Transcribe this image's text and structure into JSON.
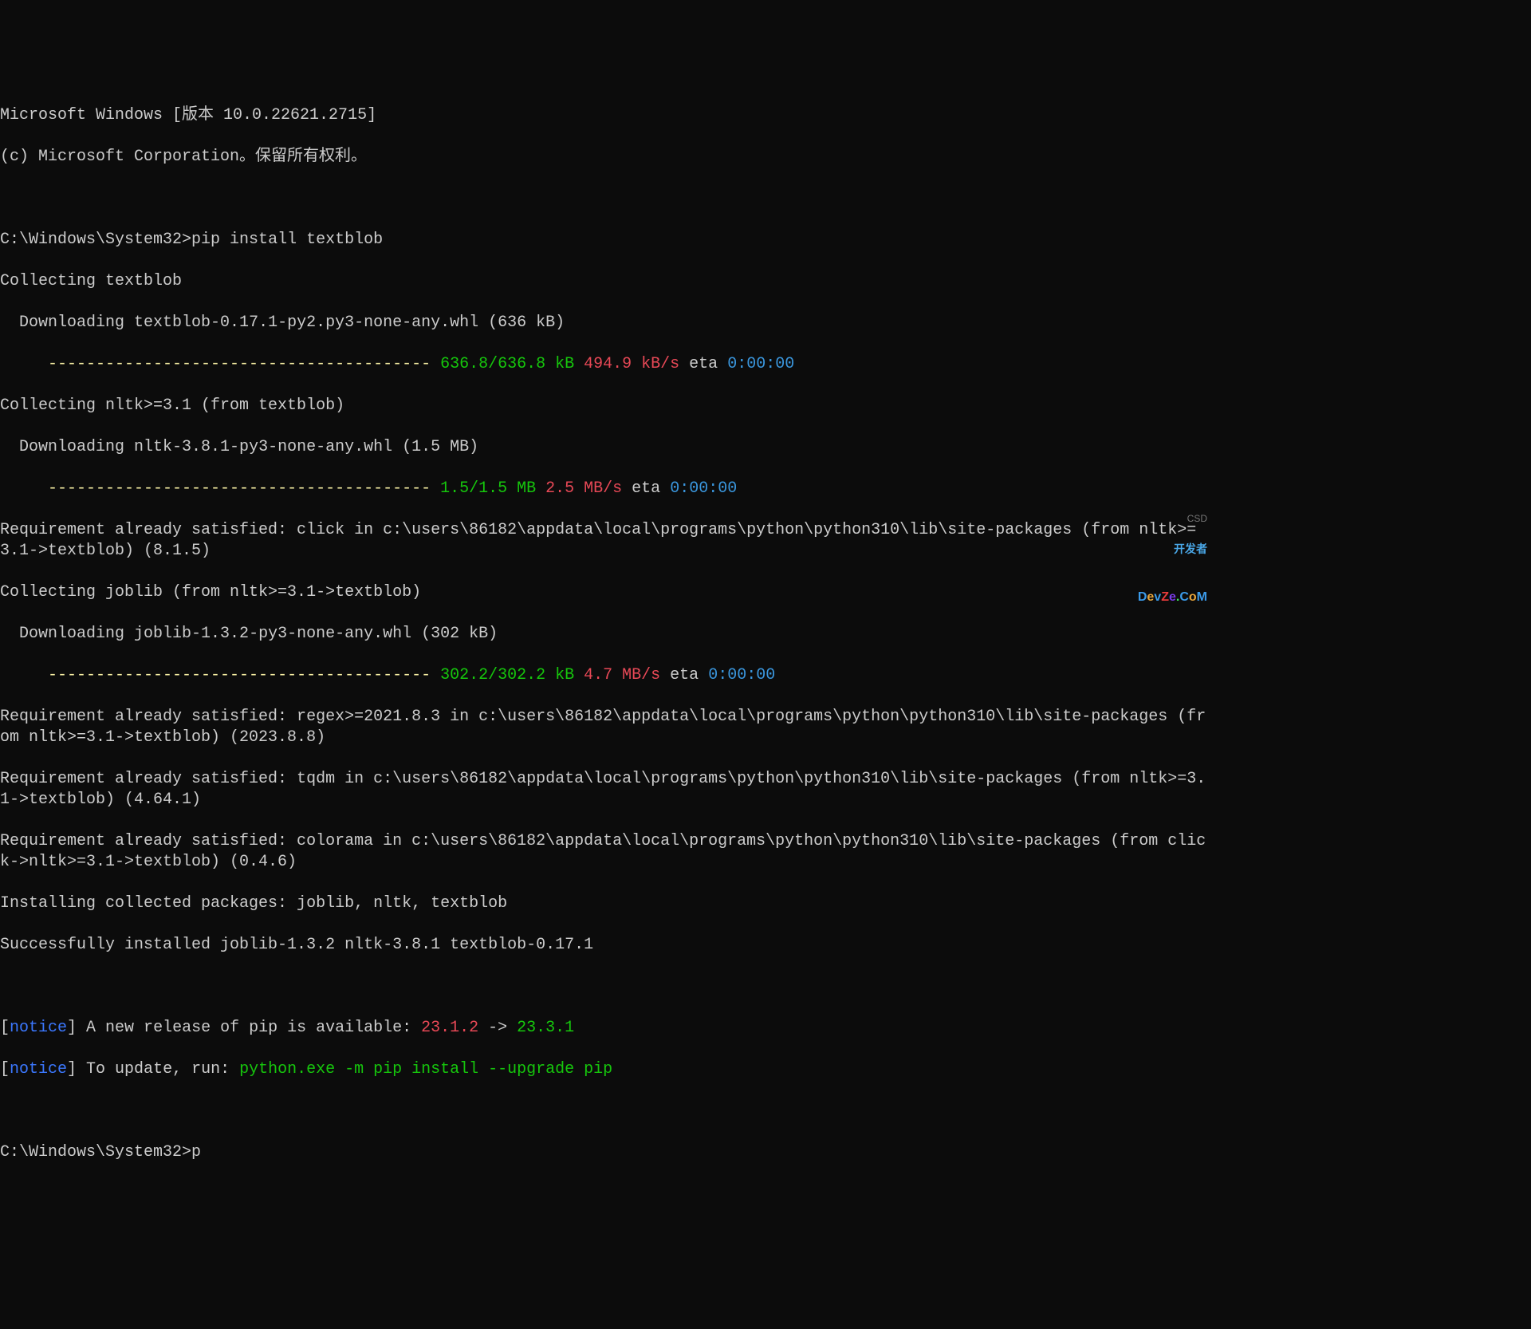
{
  "header": {
    "line1": "Microsoft Windows [版本 10.0.22621.2715]",
    "line2": "(c) Microsoft Corporation。保留所有权利。"
  },
  "prompt1": {
    "path": "C:\\Windows\\System32>",
    "command": "pip install textblob"
  },
  "output": {
    "collecting_textblob": "Collecting textblob",
    "download_textblob": "  Downloading textblob-0.17.1-py2.py3-none-any.whl (636 kB)",
    "progress1": {
      "indent": "     ",
      "bar": "---------------------------------------- ",
      "size": "636.8/636.8 kB",
      "speed": " 494.9 kB/s",
      "eta_label": " eta ",
      "eta": "0:00:00"
    },
    "collecting_nltk": "Collecting nltk>=3.1 (from textblob)",
    "download_nltk": "  Downloading nltk-3.8.1-py3-none-any.whl (1.5 MB)",
    "progress2": {
      "indent": "     ",
      "bar": "---------------------------------------- ",
      "size": "1.5/1.5 MB",
      "speed": " 2.5 MB/s",
      "eta_label": " eta ",
      "eta": "0:00:00"
    },
    "req_click": "Requirement already satisfied: click in c:\\users\\86182\\appdata\\local\\programs\\python\\python310\\lib\\site-packages (from nltk>=3.1->textblob) (8.1.5)",
    "collecting_joblib": "Collecting joblib (from nltk>=3.1->textblob)",
    "download_joblib": "  Downloading joblib-1.3.2-py3-none-any.whl (302 kB)",
    "progress3": {
      "indent": "     ",
      "bar": "---------------------------------------- ",
      "size": "302.2/302.2 kB",
      "speed": " 4.7 MB/s",
      "eta_label": " eta ",
      "eta": "0:00:00"
    },
    "req_regex": "Requirement already satisfied: regex>=2021.8.3 in c:\\users\\86182\\appdata\\local\\programs\\python\\python310\\lib\\site-packages (from nltk>=3.1->textblob) (2023.8.8)",
    "req_tqdm": "Requirement already satisfied: tqdm in c:\\users\\86182\\appdata\\local\\programs\\python\\python310\\lib\\site-packages (from nltk>=3.1->textblob) (4.64.1)",
    "req_colorama": "Requirement already satisfied: colorama in c:\\users\\86182\\appdata\\local\\programs\\python\\python310\\lib\\site-packages (from click->nltk>=3.1->textblob) (0.4.6)",
    "installing": "Installing collected packages: joblib, nltk, textblob",
    "success": "Successfully installed joblib-1.3.2 nltk-3.8.1 textblob-0.17.1"
  },
  "notices": {
    "notice1": {
      "bracket_open": "[",
      "tag": "notice",
      "bracket_close": "]",
      "text1": " A new release of pip is available: ",
      "old_version": "23.1.2",
      "arrow": " -> ",
      "new_version": "23.3.1"
    },
    "notice2": {
      "bracket_open": "[",
      "tag": "notice",
      "bracket_close": "]",
      "text1": " To update, run: ",
      "command": "python.exe -m pip install --upgrade pip"
    }
  },
  "prompt2": {
    "path": "C:\\Windows\\System32>",
    "command": "p"
  },
  "watermark": {
    "top": "开发者",
    "bottom": "DevZe.CoM",
    "csd": "CSD"
  }
}
